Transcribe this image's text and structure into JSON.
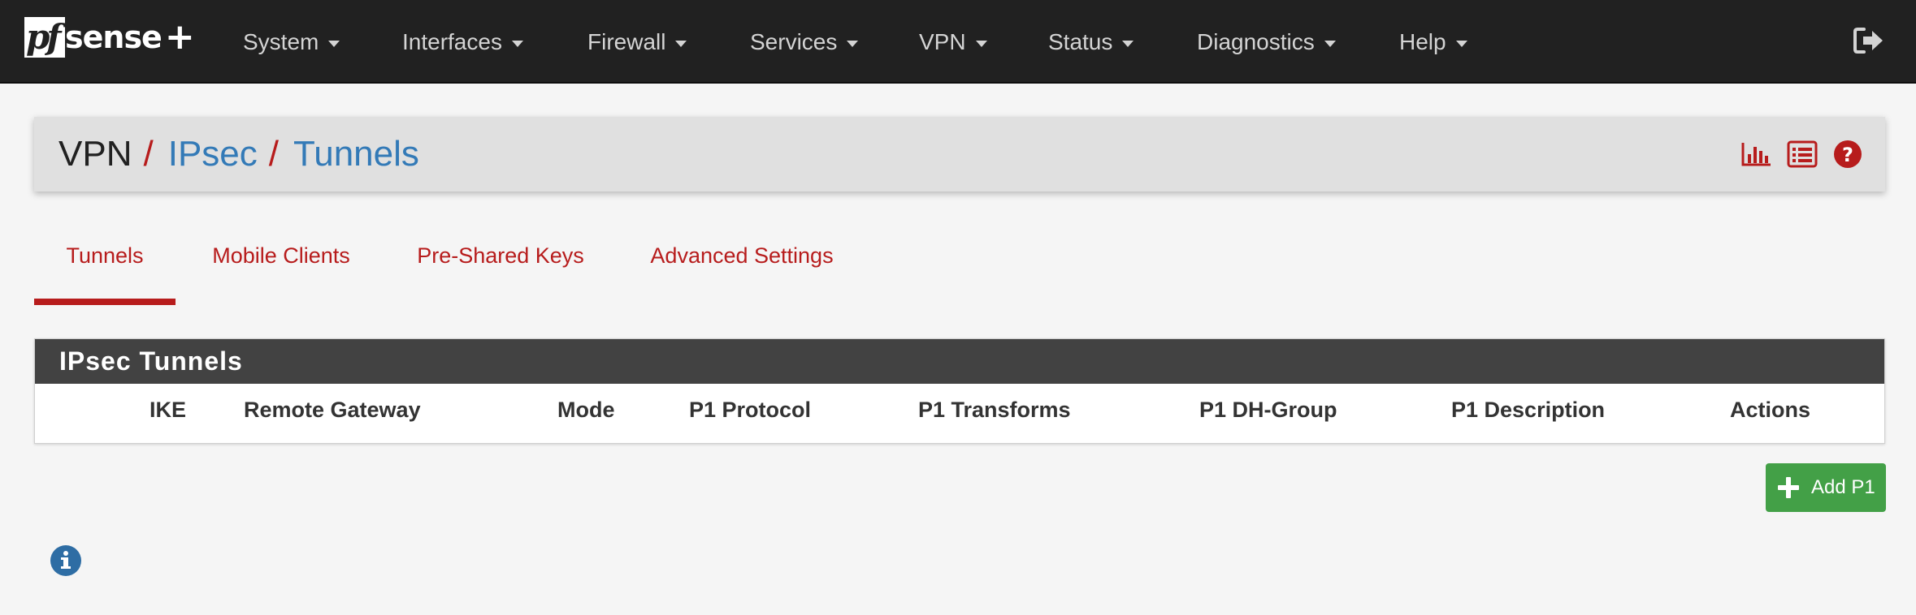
{
  "brand": {
    "logo_mark": "pf",
    "logo_text": "sense",
    "logo_plus": "+"
  },
  "nav": {
    "items": [
      {
        "label": "System"
      },
      {
        "label": "Interfaces"
      },
      {
        "label": "Firewall"
      },
      {
        "label": "Services"
      },
      {
        "label": "VPN"
      },
      {
        "label": "Status"
      },
      {
        "label": "Diagnostics"
      },
      {
        "label": "Help"
      }
    ],
    "logout_icon": "sign-out-icon"
  },
  "breadcrumb": {
    "root": "VPN",
    "section": "IPsec",
    "page": "Tunnels",
    "separator": "/"
  },
  "header_icons": [
    "bar-chart-icon",
    "list-log-icon",
    "help-circle-icon"
  ],
  "tabs": [
    {
      "label": "Tunnels",
      "active": true
    },
    {
      "label": "Mobile Clients",
      "active": false
    },
    {
      "label": "Pre-Shared Keys",
      "active": false
    },
    {
      "label": "Advanced Settings",
      "active": false
    }
  ],
  "panel": {
    "title": "IPsec Tunnels",
    "columns": [
      "IKE",
      "Remote Gateway",
      "Mode",
      "P1 Protocol",
      "P1 Transforms",
      "P1 DH-Group",
      "P1 Description",
      "Actions"
    ],
    "rows": []
  },
  "add_button": {
    "label": "Add P1",
    "icon": "plus-icon"
  },
  "info_icon": "info-circle-icon",
  "colors": {
    "navbar": "#212121",
    "accent_red": "#b71c1c",
    "link_blue": "#337ab7",
    "panel_head": "#424242",
    "success_green": "#43a047",
    "info_blue": "#2e6da4"
  }
}
